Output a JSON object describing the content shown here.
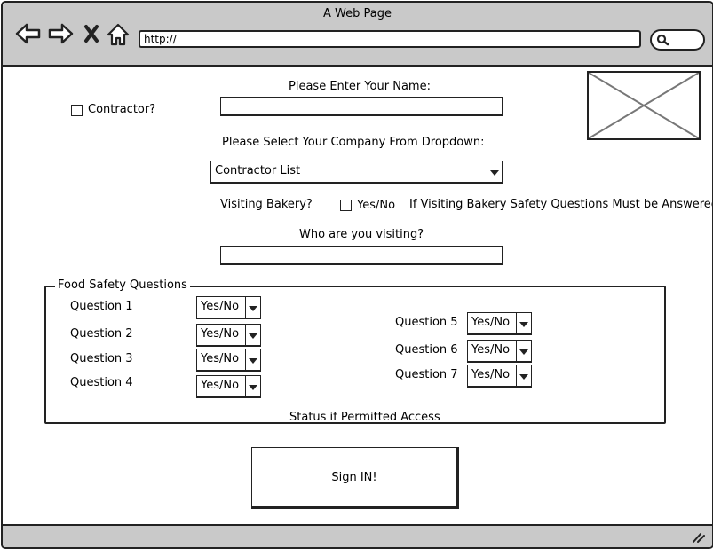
{
  "window": {
    "title": "A Web Page"
  },
  "toolbar": {
    "url": "http://",
    "icons": [
      "back-arrow-icon",
      "forward-arrow-icon",
      "close-x-icon",
      "home-icon",
      "search-icon"
    ]
  },
  "form": {
    "contractor_label": "Contractor?",
    "name_label": "Please Enter Your Name:",
    "name_value": "",
    "company_label": "Please Select Your Company From Dropdown:",
    "company_selected": "Contractor List",
    "visiting_bakery_label": "Visiting Bakery?",
    "visiting_bakery_option": "Yes/No",
    "bakery_note": "If Visiting Bakery Safety Questions Must be Answered",
    "who_visiting_label": "Who are you visiting?",
    "who_visiting_value": ""
  },
  "food_safety": {
    "legend": "Food Safety Questions",
    "questions": [
      {
        "label": "Question 1",
        "answer": "Yes/No"
      },
      {
        "label": "Question 2",
        "answer": "Yes/No"
      },
      {
        "label": "Question 3",
        "answer": "Yes/No"
      },
      {
        "label": "Question 4",
        "answer": "Yes/No"
      },
      {
        "label": "Question 5",
        "answer": "Yes/No"
      },
      {
        "label": "Question 6",
        "answer": "Yes/No"
      },
      {
        "label": "Question 7",
        "answer": "Yes/No"
      }
    ],
    "status_text": "Status if Permitted Access"
  },
  "sign_in": {
    "label": "Sign IN!"
  },
  "image": {
    "icon": "image-placeholder-icon"
  },
  "colors": {
    "chrome": "#c9c9c9",
    "stroke": "#222222",
    "background": "#ffffff"
  }
}
